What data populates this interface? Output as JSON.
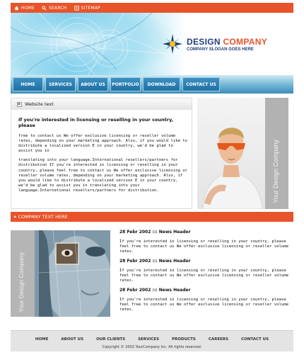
{
  "topbar": {
    "links": [
      {
        "label": "HOME",
        "icon": "home-icon"
      },
      {
        "label": "SEARCH",
        "icon": "search-icon"
      },
      {
        "label": "SITEMAP",
        "icon": "sitemap-icon"
      }
    ]
  },
  "header": {
    "company_name_1": "DESIGN",
    "company_name_2": "COMPANY",
    "slogan": "COMPANY SLOGAN GOES HERE"
  },
  "nav": {
    "items": [
      "HOME",
      "SERVICES",
      "ABOUT US",
      "PORTFOLIO",
      "DOWNLOAD",
      "CONTACT US"
    ]
  },
  "panel": {
    "title": "Website text",
    "intro": "If you're interested in licensing or reselling  in your country, please",
    "para1": " free to contact us We offer exclusive licensing or reseller volume rates, depending on your marketing approach. Also, if you would like to distribute a localized version E in your country, we'd be glad to assist you in",
    "para2": "translating  into your language.International resellers/partners for distribution If you're interested in licensing  or reselling  in your country, please feel free to contact us We offer exclusive licensing or reseller volume rates, depending on your marketing approach. Also, if you would like to distribute a localized version E in your country, we'd be glad to assist you in translating  into your language.International resellers/partners for distribution."
  },
  "side_tab": {
    "label": "Your Design Company"
  },
  "company_bar": {
    "label": "COMPANY TEXT HERE"
  },
  "low_tab": {
    "label": "Your Design Company"
  },
  "news": [
    {
      "header": "28 Febr 2002 ::: News Header",
      "text": "If you're interested in licensing or reselling  in your country, please feel free to contact us We offer exclusive licensing or reseller volume rates."
    },
    {
      "header": "28 Febr 2002 ::: News Header",
      "text": "If you're interested in licensing or reselling  in your country, please feel free to contact us We offer exclusive licensing or reseller volume rates."
    },
    {
      "header": "28 Febr 2002 ::: News Header",
      "text": "If you're interested in licensing or reselling  in your country, please feel free to contact us We offer exclusive licensing or reseller volume rates."
    }
  ],
  "footer": {
    "links": [
      "HOME",
      "ABOUT US",
      "OUR CLIENTS",
      "SERVICES",
      "PRODUCTS",
      "CAREERS",
      "CONTACT US"
    ],
    "copyright": "Copyright © 2002 YourCompany Inc. All rights reserved."
  },
  "colors": {
    "accent": "#e8532a",
    "brand_blue": "#1f3f7a",
    "nav_blue": "#2b7fb4"
  }
}
